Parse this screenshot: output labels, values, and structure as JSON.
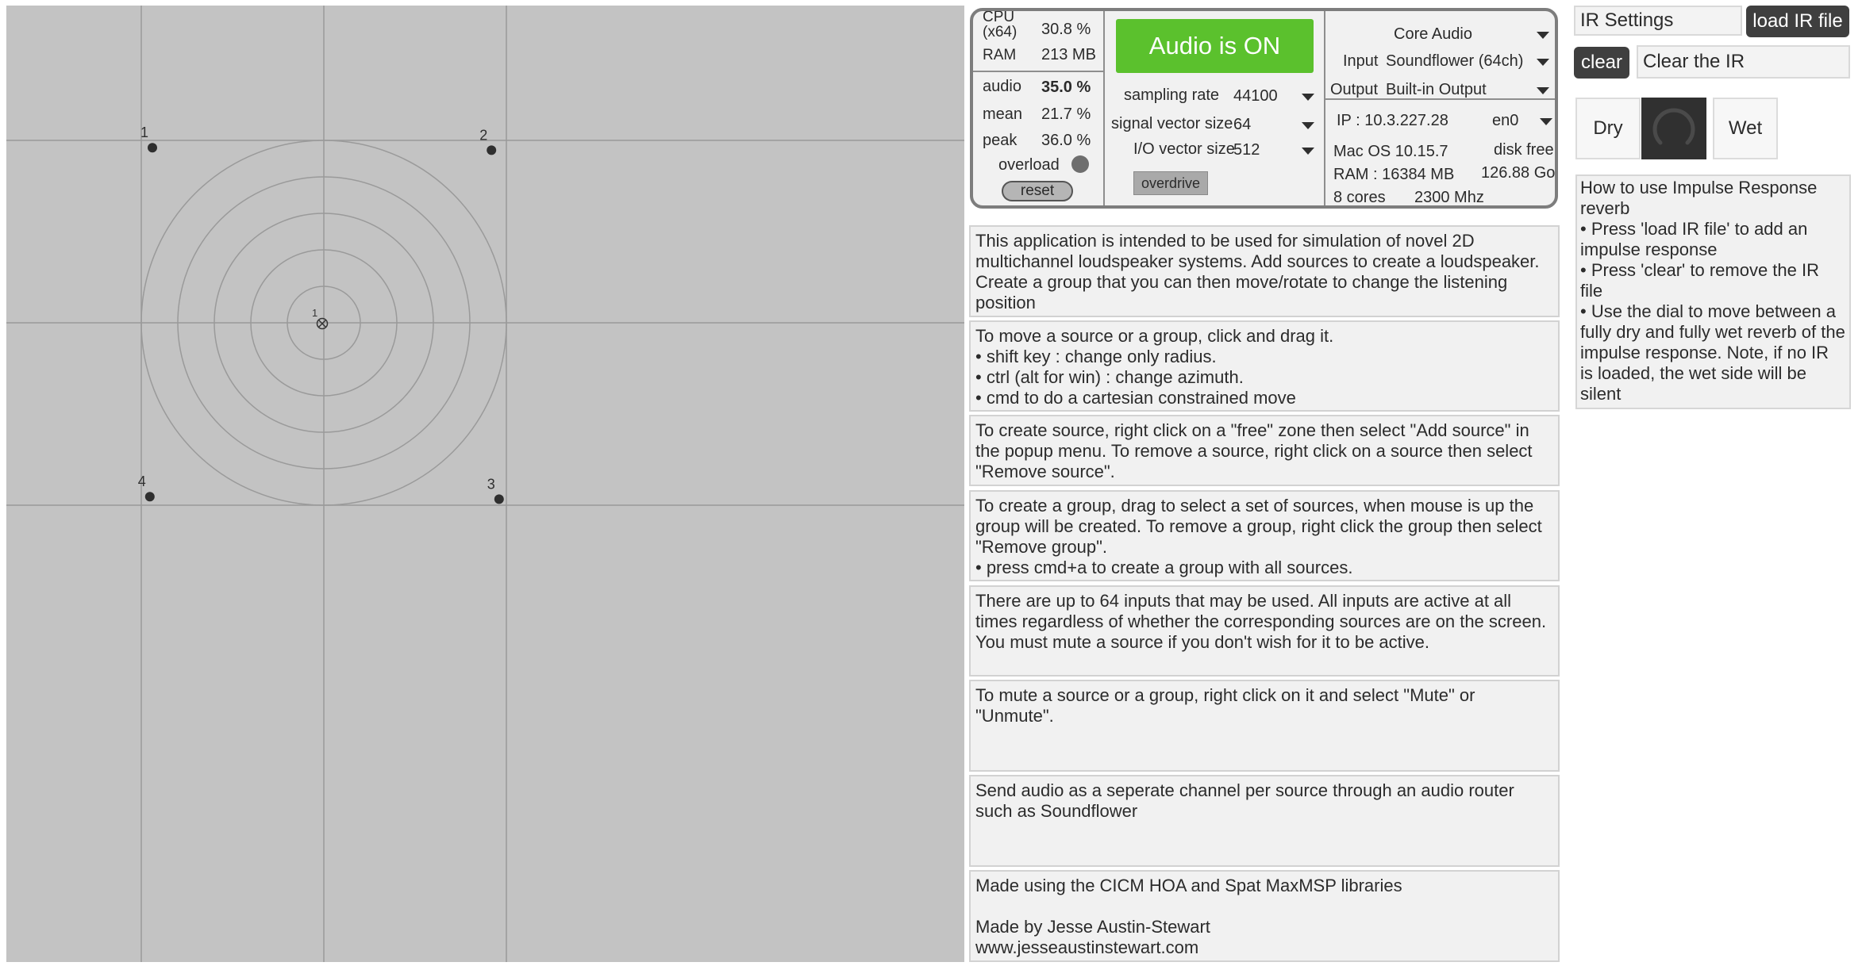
{
  "spatialiser": {
    "center_label": "1",
    "sources": [
      {
        "label": "1",
        "x": -1.35,
        "y": 1.38
      },
      {
        "label": "2",
        "x": 1.32,
        "y": 1.36
      },
      {
        "label": "3",
        "x": 1.38,
        "y": -1.39
      },
      {
        "label": "4",
        "x": -1.37,
        "y": -1.37
      }
    ]
  },
  "dsp": {
    "cpu_label": "CPU\n(x64)",
    "cpu_value": "30.8 %",
    "ram_label": "RAM",
    "ram_value": "213 MB",
    "audio_label": "audio",
    "audio_value": "35.0 %",
    "mean_label": "mean",
    "mean_value": "21.7 %",
    "peak_label": "peak",
    "peak_value": "36.0 %",
    "overload_label": "overload",
    "reset_label": "reset",
    "audio_toggle_label": "Audio is ON",
    "audio_toggle_color": "#5bc12d",
    "sampling_rate_label": "sampling rate",
    "sampling_rate_value": "44100",
    "signal_vector_label": "signal vector size",
    "signal_vector_value": "64",
    "io_vector_label": "I/O vector size",
    "io_vector_value": "512",
    "overdrive_label": "overdrive",
    "driver_value": "Core Audio",
    "input_label": "Input",
    "input_value": "Soundflower (64ch)",
    "output_label": "Output",
    "output_value": "Built-in Output",
    "ip_value": "IP : 10.3.227.28",
    "interface_value": "en0",
    "os_value": "Mac OS 10.15.7",
    "disk_free_label": "disk free",
    "sys_ram_value": "RAM : 16384 MB",
    "disk_free_value": "126.88 Go",
    "cores_value": "8 cores",
    "clock_value": "2300 Mhz"
  },
  "info_boxes": [
    "This application is intended to be used for simulation of novel 2D multichannel loudspeaker systems. Add sources to create a loudspeaker. Create a group that you can then move/rotate to change the listening position",
    "To move a source or a group, click and drag it.\n• shift key : change only radius.\n• ctrl (alt for win) : change azimuth.\n• cmd to do a cartesian constrained move",
    "To create source, right click on a \"free\" zone then select \"Add source\" in the popup menu. To remove a source, right click on a source then select \"Remove source\".",
    "To create a group, drag to select a set of sources, when mouse is up the group will be created. To remove a group, right click the group then select \"Remove group\".\n• press cmd+a to create a group with all sources.",
    "There are up to 64 inputs that may be used. All inputs are active at all times regardless of whether the corresponding sources are on the screen. You must mute a source if you don't wish for it to be active.",
    "To mute a source or a group, right click on it and select \"Mute\" or \"Unmute\".",
    "Send audio as a seperate channel per source through an audio router such as Soundflower",
    "Made using the CICM HOA and Spat MaxMSP libraries\n\nMade by Jesse Austin-Stewart\nwww.jesseaustinstewart.com"
  ],
  "ir": {
    "settings_label": "IR Settings",
    "load_label": "load IR file",
    "clear_label": "clear",
    "clear_message": "Clear the IR",
    "dry_label": "Dry",
    "wet_label": "Wet",
    "help_text": "How to use Impulse Response reverb\n• Press 'load IR file' to add an impulse response\n• Press 'clear' to remove the IR file\n• Use the dial to move between a fully dry and fully wet reverb of the impulse response. Note, if no IR is loaded, the wet side will be silent"
  }
}
